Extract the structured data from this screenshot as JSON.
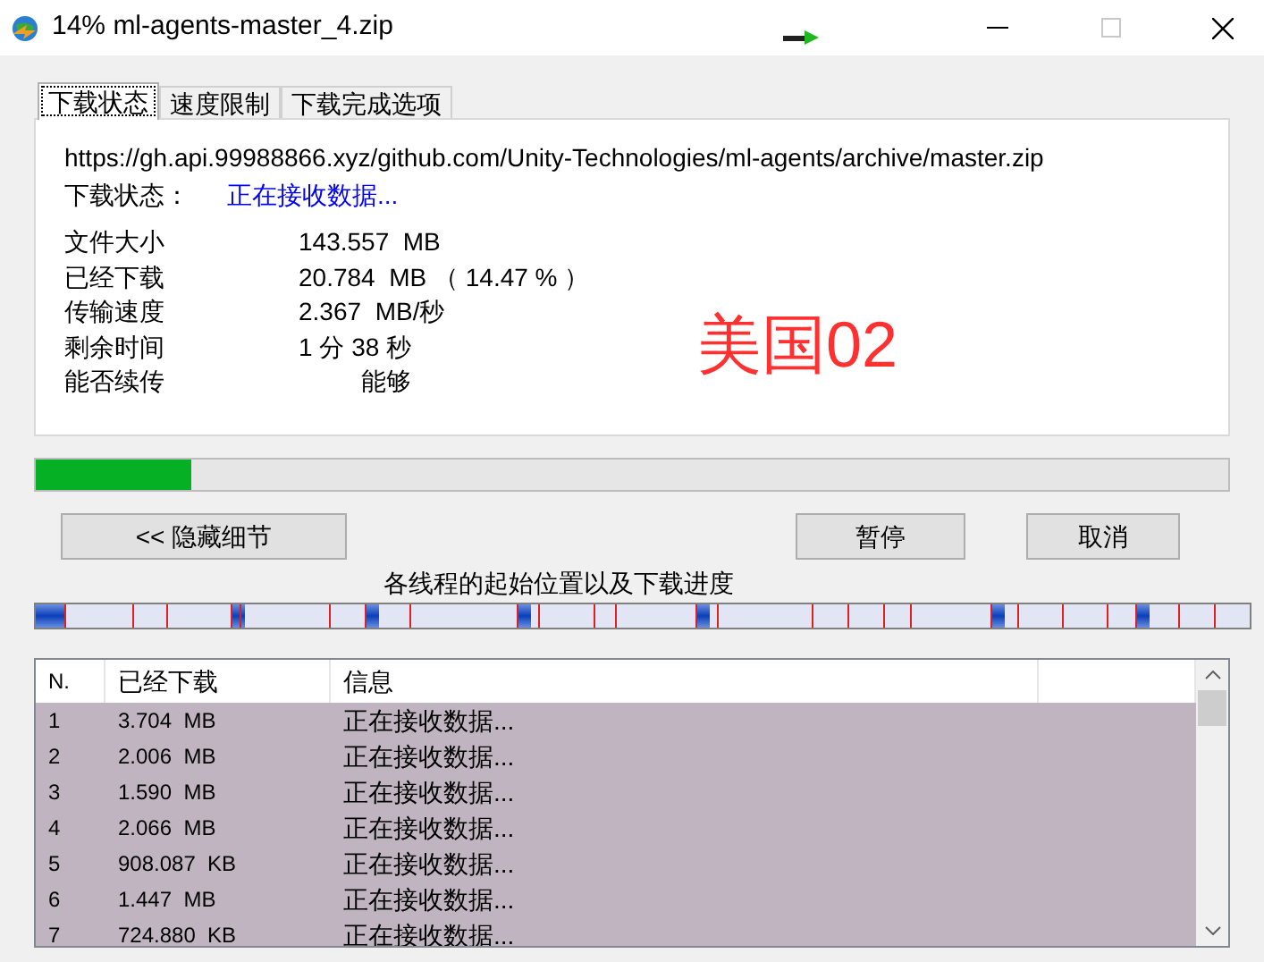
{
  "window": {
    "title": "14% ml-agents-master_4.zip",
    "maximize_disabled": true
  },
  "tabs": [
    {
      "label": "下载状态",
      "selected": true
    },
    {
      "label": "速度限制",
      "selected": false
    },
    {
      "label": "下载完成选项",
      "selected": false
    }
  ],
  "status": {
    "url": "https://gh.api.99988866.xyz/github.com/Unity-Technologies/ml-agents/archive/master.zip",
    "state_label": "下载状态：",
    "state_value": "正在接收数据...",
    "fields": [
      {
        "label": "文件大小",
        "value": "143.557  MB"
      },
      {
        "label": "已经下载",
        "value": "20.784  MB （ 14.47 % ）"
      },
      {
        "label": "传输速度",
        "value": "2.367  MB/秒"
      },
      {
        "label": "剩余时间",
        "value": "1 分 38 秒"
      },
      {
        "label": "能否续传",
        "value": "         能够"
      }
    ],
    "annotation": "美国02"
  },
  "progress": {
    "level": 0.13
  },
  "buttons": {
    "details": "<< 隐藏细节",
    "pause": "暂停",
    "cancel": "取消"
  },
  "threads_label": "各线程的起始位置以及下载进度",
  "table": {
    "columns": [
      "N.",
      "已经下载",
      "信息"
    ],
    "rows": [
      {
        "n": "1",
        "downloaded": "3.704  MB",
        "info": "正在接收数据...",
        "selected": true
      },
      {
        "n": "2",
        "downloaded": "2.006  MB",
        "info": "正在接收数据...",
        "selected": true
      },
      {
        "n": "3",
        "downloaded": "1.590  MB",
        "info": "正在接收数据...",
        "selected": true
      },
      {
        "n": "4",
        "downloaded": "2.066  MB",
        "info": "正在接收数据...",
        "selected": true
      },
      {
        "n": "5",
        "downloaded": "908.087  KB",
        "info": "正在接收数据...",
        "selected": true
      },
      {
        "n": "6",
        "downloaded": "1.447  MB",
        "info": "正在接收数据...",
        "selected": true
      },
      {
        "n": "7",
        "downloaded": "724.880  KB",
        "info": "正在接收数据...",
        "selected": true
      }
    ]
  }
}
